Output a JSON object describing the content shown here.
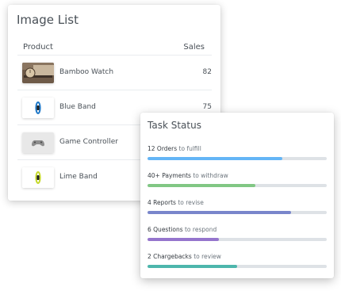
{
  "image_list": {
    "title": "Image List",
    "columns": {
      "product": "Product",
      "sales": "Sales"
    },
    "rows": [
      {
        "name": "Bamboo Watch",
        "sales": "82",
        "thumb_icon": "bamboo-watch-icon"
      },
      {
        "name": "Blue Band",
        "sales": "75",
        "thumb_icon": "blue-band-icon"
      },
      {
        "name": "Game Controller",
        "sales": "",
        "thumb_icon": "game-controller-icon"
      },
      {
        "name": "Lime Band",
        "sales": "",
        "thumb_icon": "lime-band-icon"
      }
    ]
  },
  "task_status": {
    "title": "Task Status",
    "tasks": [
      {
        "strong": "12 Orders",
        "rest": " to fulfill",
        "progress": 0.75,
        "color": "#64b5f6"
      },
      {
        "strong": "40+ Payments",
        "rest": " to withdraw",
        "progress": 0.6,
        "color": "#81c784"
      },
      {
        "strong": "4 Reports",
        "rest": " to revise",
        "progress": 0.8,
        "color": "#7986cb"
      },
      {
        "strong": "6 Questions",
        "rest": " to respond",
        "progress": 0.4,
        "color": "#9575cd"
      },
      {
        "strong": "2 Chargebacks",
        "rest": " to review",
        "progress": 0.5,
        "color": "#4db6ac"
      }
    ]
  }
}
